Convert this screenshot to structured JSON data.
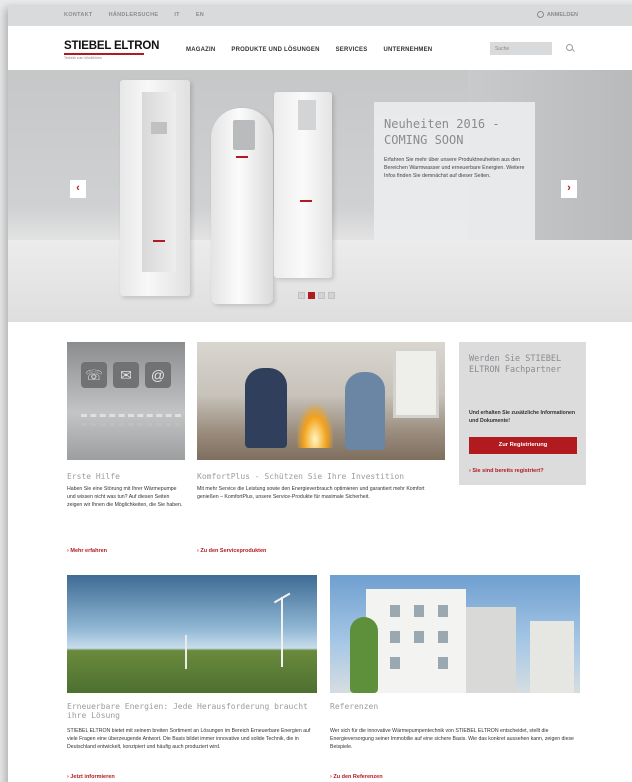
{
  "util": {
    "links": [
      "KONTAKT",
      "HÄNDLERSUCHE",
      "IT",
      "EN"
    ],
    "login": "ANMELDEN"
  },
  "header": {
    "logo_name": "STIEBEL ELTRON",
    "logo_tagline": "Technik zum Wohlfühlen",
    "nav": [
      "MAGAZIN",
      "PRODUKTE UND LÖSUNGEN",
      "SERVICES",
      "UNTERNEHMEN"
    ],
    "search_placeholder": "Suche"
  },
  "hero": {
    "title": "Neuheiten 2016 - COMING SOON",
    "text": "Erfahren Sie mehr über unsere Produktneuheiten aus den Bereichen Warmwasser und erneuerbare Energien. Weitere Infos finden Sie demnächst auf dieser Seiten.",
    "prev": "‹",
    "next": "›",
    "slides": 4,
    "active_slide": 2
  },
  "cards": [
    {
      "title": "Erste Hilfe",
      "text": "Haben Sie eine Störung mit Ihrer Wärmepumpe und wissen nicht was tun? Auf diesen Seiten zeigen wir Ihnen die Möglichkeiten, die Sie haben.",
      "link": "› Mehr erfahren"
    },
    {
      "title": "KomfortPlus - Schützen Sie Ihre Investition",
      "text": "Mit mehr Service die Leistung sowie den Energieverbrauch optimieren und garantiert mehr Komfort genießen – KomfortPlus, unsere Service-Produkte für maximale Sicherheit.",
      "link": "› Zu den Serviceprodukten"
    },
    {
      "title": "Erneuerbare Energien: Jede Herausforderung braucht ihre Lösung",
      "text": "STIEBEL ELTRON bietet mit seinem breiten Sortiment an Lösungen im Bereich Erneuerbare Energien auf viele Fragen eine überzeugende Antwort. Die Basis bildet immer innovative und solide Technik, die in Deutschland entwickelt, konzipiert und häufig auch produziert wird.",
      "link": "› Jetzt informieren"
    },
    {
      "title": "Referenzen",
      "text": "Wer sich für die innovative Wärmepumpentechnik von STIEBEL ELTRON entscheidet, stellt die Energieversorgung seiner Immobilie auf eine sichere Basis. Wie das konkret aussehen kann, zeigen diese Beispiele.",
      "link": "› Zu den Referenzen"
    }
  ],
  "partner": {
    "title": "Werden Sie STIEBEL ELTRON Fachpartner",
    "text": "Und erhalten Sie zusätzliche Informationen und Dokumente!",
    "button": "Zur Registrierung",
    "link": "› Sie sind bereits registriert?"
  },
  "icons": {
    "img1": [
      "☏",
      "✉",
      "@"
    ]
  },
  "colors": {
    "accent": "#b11a1f",
    "heading_gray": "#8a8c8f"
  }
}
